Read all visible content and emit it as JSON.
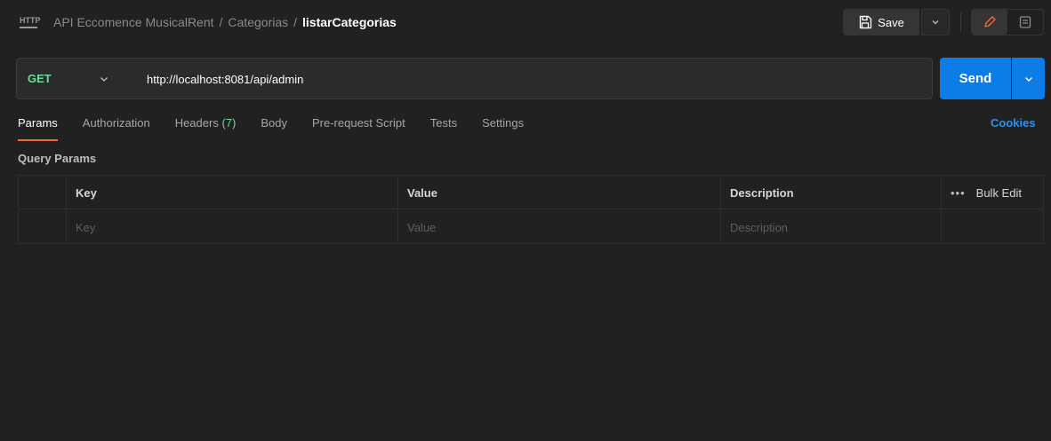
{
  "header": {
    "http_icon_label": "HTTP",
    "breadcrumb": [
      "API Eccomence MusicalRent",
      "Categorias"
    ],
    "current": "listarCategorias",
    "save_label": "Save",
    "icons": [
      "save-icon",
      "chevron-down-icon",
      "pencil-icon",
      "comment-icon"
    ],
    "pencil_color": "#f26b3a"
  },
  "request": {
    "method": "GET",
    "method_color": "#6bdd9a",
    "url": "http://localhost:8081/api/admin",
    "send_label": "Send",
    "send_color": "#0c7ce6"
  },
  "tabs": [
    {
      "label": "Params",
      "active": true
    },
    {
      "label": "Authorization"
    },
    {
      "label": "Headers",
      "count": "(7)"
    },
    {
      "label": "Body"
    },
    {
      "label": "Pre-request Script"
    },
    {
      "label": "Tests"
    },
    {
      "label": "Settings"
    }
  ],
  "cookies_label": "Cookies",
  "query_params": {
    "title": "Query Params",
    "columns": [
      "Key",
      "Value",
      "Description"
    ],
    "bulk_edit": "Bulk Edit",
    "more_label": "•••",
    "placeholders": {
      "key": "Key",
      "value": "Value",
      "description": "Description"
    }
  }
}
